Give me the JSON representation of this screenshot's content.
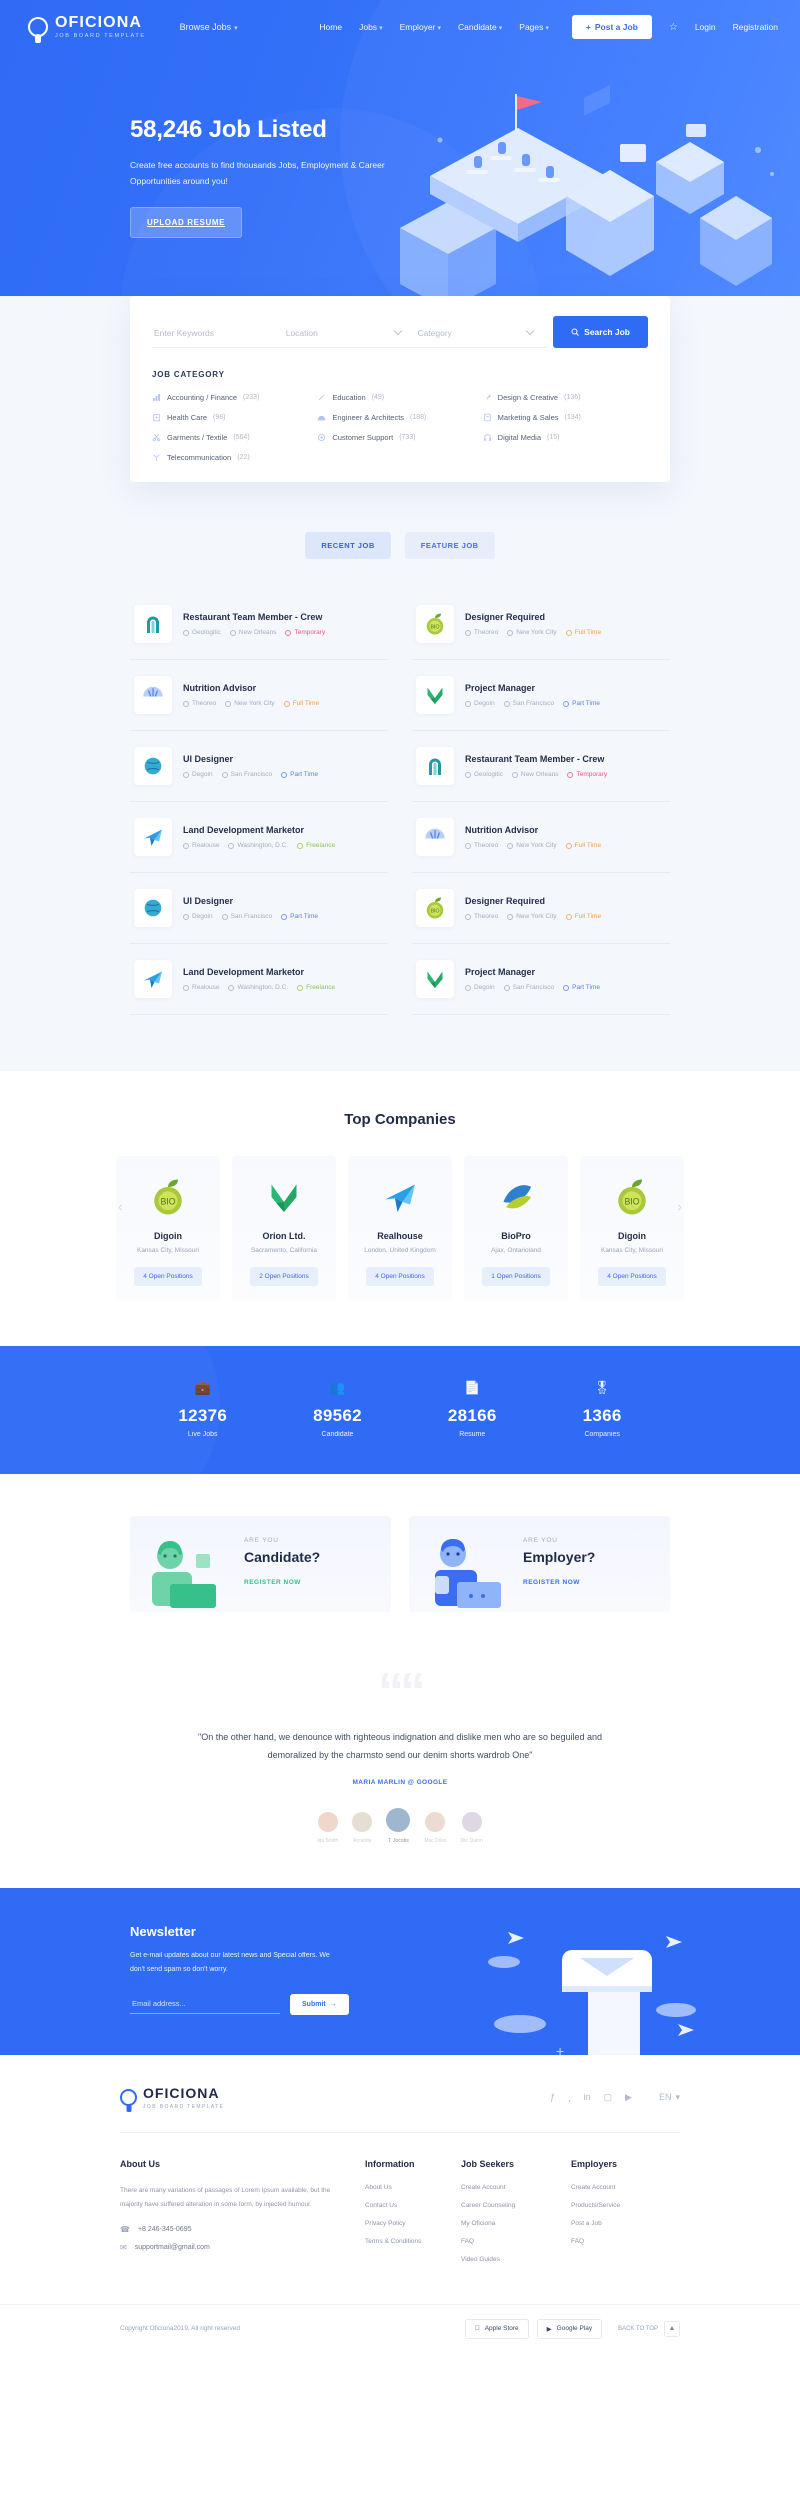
{
  "brand": {
    "name": "OFICIONA",
    "tagline": "JOB BOARD TEMPLATE"
  },
  "header": {
    "browse_label": "Browse Jobs",
    "nav": [
      {
        "label": "Home",
        "caret": false
      },
      {
        "label": "Jobs",
        "caret": true
      },
      {
        "label": "Employer",
        "caret": true
      },
      {
        "label": "Candidate",
        "caret": true
      },
      {
        "label": "Pages",
        "caret": true
      }
    ],
    "post_job": "Post a Job",
    "login": "Login",
    "registration": "Registration"
  },
  "hero": {
    "title": "58,246 Job Listed",
    "subtitle": "Create free accounts to find thousands Jobs, Employment & Career Opportunities around you!",
    "button": "UPLOAD RESUME"
  },
  "search": {
    "keyword_placeholder": "Enter Keywords",
    "location_placeholder": "Location",
    "category_placeholder": "Category",
    "button": "Search Job",
    "category_heading": "JOB CATEGORY",
    "categories": [
      {
        "label": "Accounting / Finance",
        "count": "(233)",
        "icon": "chart-icon"
      },
      {
        "label": "Education",
        "count": "(49)",
        "icon": "pencil-icon"
      },
      {
        "label": "Design & Creative",
        "count": "(136)",
        "icon": "brush-icon"
      },
      {
        "label": "Health Care",
        "count": "(98)",
        "icon": "hospital-icon"
      },
      {
        "label": "Engineer & Architects",
        "count": "(188)",
        "icon": "helmet-icon"
      },
      {
        "label": "Marketing & Sales",
        "count": "(134)",
        "icon": "tag-icon"
      },
      {
        "label": "Garments / Textile",
        "count": "(564)",
        "icon": "scissors-icon"
      },
      {
        "label": "Customer Support",
        "count": "(733)",
        "icon": "support-icon"
      },
      {
        "label": "Digital Media",
        "count": "(15)",
        "icon": "headphone-icon"
      },
      {
        "label": "Telecommunication",
        "count": "(22)",
        "icon": "antenna-icon"
      }
    ]
  },
  "tabs": [
    {
      "label": "RECENT JOB",
      "active": true
    },
    {
      "label": "FEATURE JOB",
      "active": false
    }
  ],
  "jobs": [
    {
      "title": "Restaurant Team Member - Crew",
      "company": "Geologitic",
      "location": "New Orleans",
      "type": "Temporary",
      "type_class": "m-type-temp",
      "logo": "arch-logo"
    },
    {
      "title": "Designer Required",
      "company": "Theoreo",
      "location": "New York City",
      "type": "Full Time",
      "type_class": "m-type-full",
      "logo": "bio-logo"
    },
    {
      "title": "Nutrition Advisor",
      "company": "Theoreo",
      "location": "New York City",
      "type": "Full Time",
      "type_class": "m-type-full",
      "logo": "fan-logo"
    },
    {
      "title": "Project Manager",
      "company": "Degoin",
      "location": "San Francisco",
      "type": "Part Time",
      "type_class": "m-type-part",
      "logo": "leaf-logo"
    },
    {
      "title": "UI Designer",
      "company": "Degoin",
      "location": "San Francisco",
      "type": "Part Time",
      "type_class": "m-type-part",
      "logo": "globe-logo"
    },
    {
      "title": "Restaurant Team Member - Crew",
      "company": "Geologitic",
      "location": "New Orleans",
      "type": "Temporary",
      "type_class": "m-type-temp",
      "logo": "arch-logo"
    },
    {
      "title": "Land Development Marketor",
      "company": "Realouse",
      "location": "Washington, D.C.",
      "type": "Freelance",
      "type_class": "m-type-free",
      "logo": "bird-logo"
    },
    {
      "title": "Nutrition Advisor",
      "company": "Theoreo",
      "location": "New York City",
      "type": "Full Time",
      "type_class": "m-type-full",
      "logo": "fan-logo"
    },
    {
      "title": "UI Designer",
      "company": "Degoin",
      "location": "San Francisco",
      "type": "Part Time",
      "type_class": "m-type-part",
      "logo": "globe-logo"
    },
    {
      "title": "Designer Required",
      "company": "Theoreo",
      "location": "New York City",
      "type": "Full Time",
      "type_class": "m-type-full",
      "logo": "bio-logo"
    },
    {
      "title": "Land Development Marketor",
      "company": "Realouse",
      "location": "Washington, D.C.",
      "type": "Freelance",
      "type_class": "m-type-free",
      "logo": "bird-logo"
    },
    {
      "title": "Project Manager",
      "company": "Degoin",
      "location": "San Francisco",
      "type": "Part Time",
      "type_class": "m-type-part",
      "logo": "leaf-logo"
    }
  ],
  "companies": {
    "title": "Top Companies",
    "items": [
      {
        "name": "Digoin",
        "location": "Kansas City, Missouri",
        "positions": "4 Open Positions",
        "logo": "bio-logo"
      },
      {
        "name": "Orion Ltd.",
        "location": "Sacramento, California",
        "positions": "2 Open Positions",
        "logo": "leaf-logo"
      },
      {
        "name": "Realhouse",
        "location": "London, United Kingdom",
        "positions": "4 Open Positions",
        "logo": "bird-logo"
      },
      {
        "name": "BioPro",
        "location": "Ajax, Ontarioland",
        "positions": "1 Open Positions",
        "logo": "swirl-logo"
      },
      {
        "name": "Digoin",
        "location": "Kansas City, Missouri",
        "positions": "4 Open Positions",
        "logo": "bio-logo"
      }
    ]
  },
  "stats": [
    {
      "value": "12376",
      "label": "Live Jobs",
      "icon": "briefcase-icon"
    },
    {
      "value": "89562",
      "label": "Candidate",
      "icon": "users-icon"
    },
    {
      "value": "28166",
      "label": "Resume",
      "icon": "document-icon"
    },
    {
      "value": "1366",
      "label": "Companies",
      "icon": "badge-icon"
    }
  ],
  "cta": [
    {
      "kicker": "ARE YOU",
      "title": "Candidate?",
      "link": "REGISTER NOW",
      "art": "candidate-illustration"
    },
    {
      "kicker": "ARE YOU",
      "title": "Employer?",
      "link": "REGISTER NOW",
      "art": "employer-illustration"
    }
  ],
  "testimonial": {
    "quote": "\"On the other hand, we denounce with righteous indignation and dislike men who are so beguiled and demoralized by the charmsto send our denim shorts wardrob One\"",
    "author": "MARIA MARLIN @ GOOGLE",
    "avatars": [
      {
        "name": "Iqu Smith",
        "active": false
      },
      {
        "name": "Arcanite",
        "active": false
      },
      {
        "name": "T. Jocobs",
        "active": true
      },
      {
        "name": "Mac Dilan",
        "active": false
      },
      {
        "name": "Dio Quinn",
        "active": false
      }
    ]
  },
  "newsletter": {
    "title": "Newsletter",
    "subtitle": "Get e-mail updates about our latest news and Special offers. We don't send spam so don't worry.",
    "input_placeholder": "Email address...",
    "button": "Submit"
  },
  "footer": {
    "language": "EN",
    "social": [
      "facebook-icon",
      "twitter-icon",
      "linkedin-icon",
      "instagram-icon",
      "youtube-icon"
    ],
    "about": {
      "heading": "About Us",
      "text": "There are many variations of passages of Lorem Ipsum available, but the majority have suffered alteration in some form, by injected humour.",
      "phone": "+8 246-345-0695",
      "email": "supportmail@gmail.com"
    },
    "columns": [
      {
        "heading": "Information",
        "links": [
          "About Us",
          "Contact Us",
          "Privacy Policy",
          "Terms & Conditions"
        ]
      },
      {
        "heading": "Job Seekers",
        "links": [
          "Create Account",
          "Career Counseling",
          "My Oficiona",
          "FAQ",
          "Video Guides"
        ]
      },
      {
        "heading": "Employers",
        "links": [
          "Create Account",
          "Products/Service",
          "Post a Job",
          "FAQ"
        ]
      }
    ],
    "copyright": "Copyright Oficiona2019, All right reserved",
    "apple_store": "Apple Store",
    "google_play": "Google Play",
    "back_to_top": "BACK TO TOP"
  },
  "colors": {
    "primary": "#2f6bf5",
    "accent_light": "#4a87ff",
    "text": "#2d3958"
  }
}
